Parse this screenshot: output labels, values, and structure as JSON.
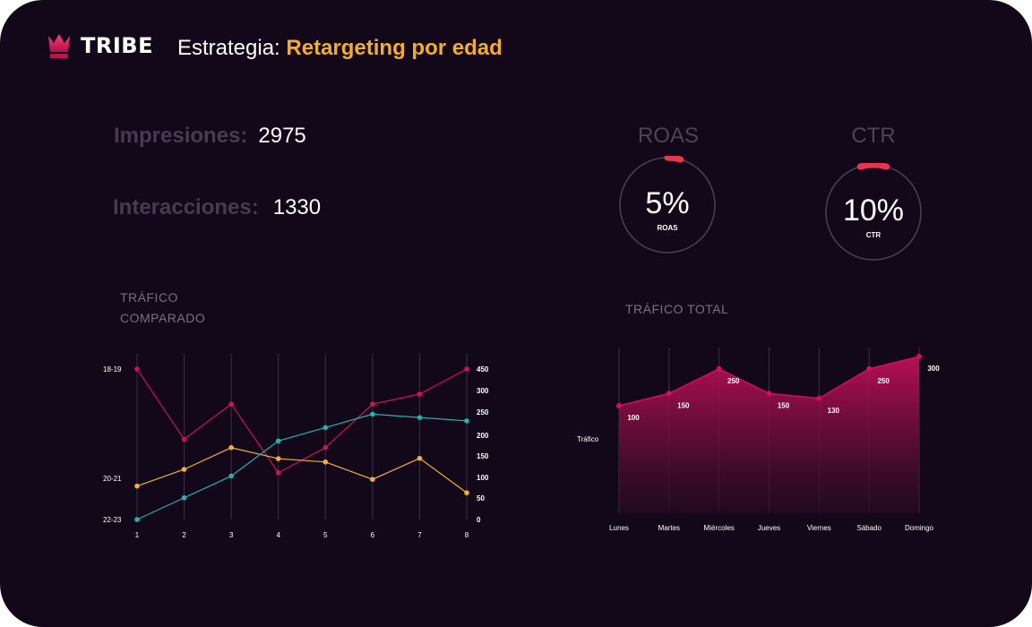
{
  "header": {
    "brand": "TRIBE",
    "strategy_label": "Estrategia:",
    "strategy_name": "Retargeting por edad"
  },
  "metrics": {
    "impressions_label": "Impresiones:",
    "impressions_value": "2975",
    "interactions_label": "Interacciones:",
    "interactions_value": "1330"
  },
  "kpis": {
    "roas": {
      "title": "ROAS",
      "value": "5%",
      "sublabel": "ROAS",
      "progress": 0.05
    },
    "ctr": {
      "title": "CTR",
      "value": "10%",
      "sublabel": "CTR",
      "progress": 0.1
    }
  },
  "colors": {
    "accent_red": "#e8344f",
    "magenta": "#d0105c",
    "yellow": "#f2b134",
    "teal": "#1fb5b0",
    "highlight": "#f2ad2b"
  },
  "chart_data": [
    {
      "type": "line",
      "title": "TRÁFICO COMPARADO",
      "title_lines": [
        "TRÁFICO",
        "COMPARADO"
      ],
      "x": [
        1,
        2,
        3,
        4,
        5,
        6,
        7,
        8
      ],
      "left_categories": [
        "18-19",
        "20-21",
        "22-23"
      ],
      "y_ticks": [
        0,
        50,
        100,
        150,
        200,
        250,
        300,
        450
      ],
      "series": [
        {
          "values": [
            450,
            240,
            345,
            140,
            215,
            345,
            375,
            450
          ]
        },
        {
          "values": [
            100,
            150,
            215,
            182,
            172,
            120,
            183,
            80
          ]
        },
        {
          "values": [
            0,
            65,
            130,
            235,
            275,
            315,
            305,
            295
          ]
        }
      ]
    },
    {
      "type": "area",
      "title": "TRÁFICO TOTAL",
      "ylabel": "Tráfico",
      "categories": [
        "Lunes",
        "Martes",
        "Miércoles",
        "Jueves",
        "Viernes",
        "Sábado",
        "Domingo"
      ],
      "values": [
        100,
        150,
        250,
        150,
        130,
        250,
        300
      ]
    }
  ]
}
